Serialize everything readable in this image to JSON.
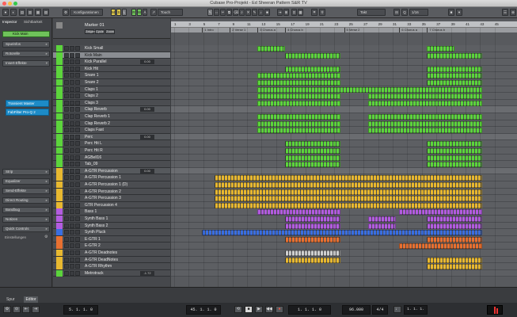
{
  "window": {
    "title": "Cubase Pro-Projekt - Ed Sheeran Pattern S&R TV"
  },
  "toolbar": {
    "config_label": "Konfigurationen",
    "mode_label": "Touch",
    "quantize_label": "Takt",
    "grid_label": "1/16",
    "letters": [
      "M",
      "S",
      "L",
      "R",
      "W",
      "A"
    ]
  },
  "inspector": {
    "tab_inspector": "Inspector",
    "tab_visibility": "Sichtbarkeit",
    "track_name": "Kick Main",
    "sections": [
      "Spurinfos",
      "Rotorelle",
      "Insert-Effekte"
    ],
    "inserts": [
      "Transient Master",
      "FabFilter Pro-Q 2"
    ],
    "lower_sections": [
      "Strip",
      "Equalizer",
      "Send-Effekte",
      "Direct Routing",
      "Bandbug",
      "Notizen",
      "Quick Controls",
      "Einstellungen"
    ],
    "bottom_tabs": [
      "Spur",
      "Editor"
    ]
  },
  "marker_track": {
    "name": "Marker 01",
    "buttons": [
      "Zeigen",
      "Cycle",
      "Zoom"
    ]
  },
  "tracks": [
    {
      "name": "Kick Small",
      "color": "#5cd43c",
      "value": ""
    },
    {
      "name": "Kick Main",
      "color": "#5cd43c",
      "value": "",
      "selected": true
    },
    {
      "name": "Kick Parallel",
      "color": "#5cd43c",
      "value": "0.00"
    },
    {
      "name": "Kick Hit",
      "color": "#5cd43c",
      "value": ""
    },
    {
      "name": "Snare 1",
      "color": "#5cd43c",
      "value": ""
    },
    {
      "name": "Snare 2",
      "color": "#5cd43c",
      "value": ""
    },
    {
      "name": "Claps 1",
      "color": "#5cd43c",
      "value": ""
    },
    {
      "name": "Claps 2",
      "color": "#5cd43c",
      "value": ""
    },
    {
      "name": "Claps 3",
      "color": "#5cd43c",
      "value": ""
    },
    {
      "name": "Clap Reverb",
      "color": "#5cd43c",
      "value": "0.00",
      "folder": true
    },
    {
      "name": "Clap Reverb 1",
      "color": "#5cd43c",
      "value": ""
    },
    {
      "name": "Clap Reverb 2",
      "color": "#5cd43c",
      "value": ""
    },
    {
      "name": "Claps Fast",
      "color": "#5cd43c",
      "value": ""
    },
    {
      "name": "Perc",
      "color": "#5cd43c",
      "value": "0.00",
      "folder": true
    },
    {
      "name": "Perc Hit L",
      "color": "#5cd43c",
      "value": ""
    },
    {
      "name": "Perc Hit R",
      "color": "#5cd43c",
      "value": ""
    },
    {
      "name": "AGBell16",
      "color": "#5cd43c",
      "value": ""
    },
    {
      "name": "Tab_09",
      "color": "#5cd43c",
      "value": ""
    },
    {
      "name": "A-GTR Percussion",
      "color": "#e8b830",
      "value": "0.00",
      "folder": true
    },
    {
      "name": "A-GTR Percussion 1",
      "color": "#e8b830",
      "value": ""
    },
    {
      "name": "A-GTR Percussion 1 (D)",
      "color": "#e8b830",
      "value": ""
    },
    {
      "name": "A-GTR Percussion 2",
      "color": "#e8b830",
      "value": ""
    },
    {
      "name": "A-GTR Percussion 3",
      "color": "#e8b830",
      "value": ""
    },
    {
      "name": "GTR Percussion 4",
      "color": "#e8b830",
      "value": ""
    },
    {
      "name": "Bass 1",
      "color": "#b35ce0",
      "value": ""
    },
    {
      "name": "Synth Bass 1",
      "color": "#b35ce0",
      "value": ""
    },
    {
      "name": "Synth Bass 2",
      "color": "#b35ce0",
      "value": ""
    },
    {
      "name": "Synth Pluck",
      "color": "#3a6ee0",
      "value": ""
    },
    {
      "name": "E-GTR 1",
      "color": "#e87030",
      "value": ""
    },
    {
      "name": "E-GTR 2",
      "color": "#e87030",
      "value": ""
    },
    {
      "name": "A-GTR Deadnotes",
      "color": "#e8b830",
      "value": ""
    },
    {
      "name": "A-GTR DeadNotes",
      "color": "#e8b830",
      "value": ""
    },
    {
      "name": "A-GTR Rhythm",
      "color": "#e8b830",
      "value": ""
    },
    {
      "name": "Metrotrack",
      "color": "#5cd43c",
      "value": "-1.72"
    }
  ],
  "ruler": {
    "bars": [
      "1",
      "3",
      "5",
      "7",
      "9",
      "11",
      "13",
      "15",
      "17",
      "19",
      "21",
      "23",
      "25",
      "27",
      "29",
      "31",
      "33",
      "35",
      "37",
      "39",
      "41",
      "43",
      "45"
    ]
  },
  "markers": [
    {
      "label": "1 Intro",
      "pos": 0.09
    },
    {
      "label": "2 Verse 1",
      "pos": 0.17
    },
    {
      "label": "3 Chorus a",
      "pos": 0.25
    },
    {
      "label": "4 Chorus b",
      "pos": 0.33
    },
    {
      "label": "5 Verse 2",
      "pos": 0.5
    },
    {
      "label": "6 Chorus a",
      "pos": 0.66
    },
    {
      "label": "7 Chorus b",
      "pos": 0.74
    }
  ],
  "transport": {
    "left_locator": "5. 1. 1. 0",
    "right_locator": "45. 1. 1. 0",
    "position": "1. 1. 1. 0",
    "tempo": "96.000",
    "signature": "4/4",
    "extra": "1. 1. 1."
  },
  "colors": {
    "drums": "#5cd43c",
    "guitar": "#e8b830",
    "synth": "#b35ce0",
    "pluck": "#3a6ee0",
    "egtr": "#e87030"
  }
}
